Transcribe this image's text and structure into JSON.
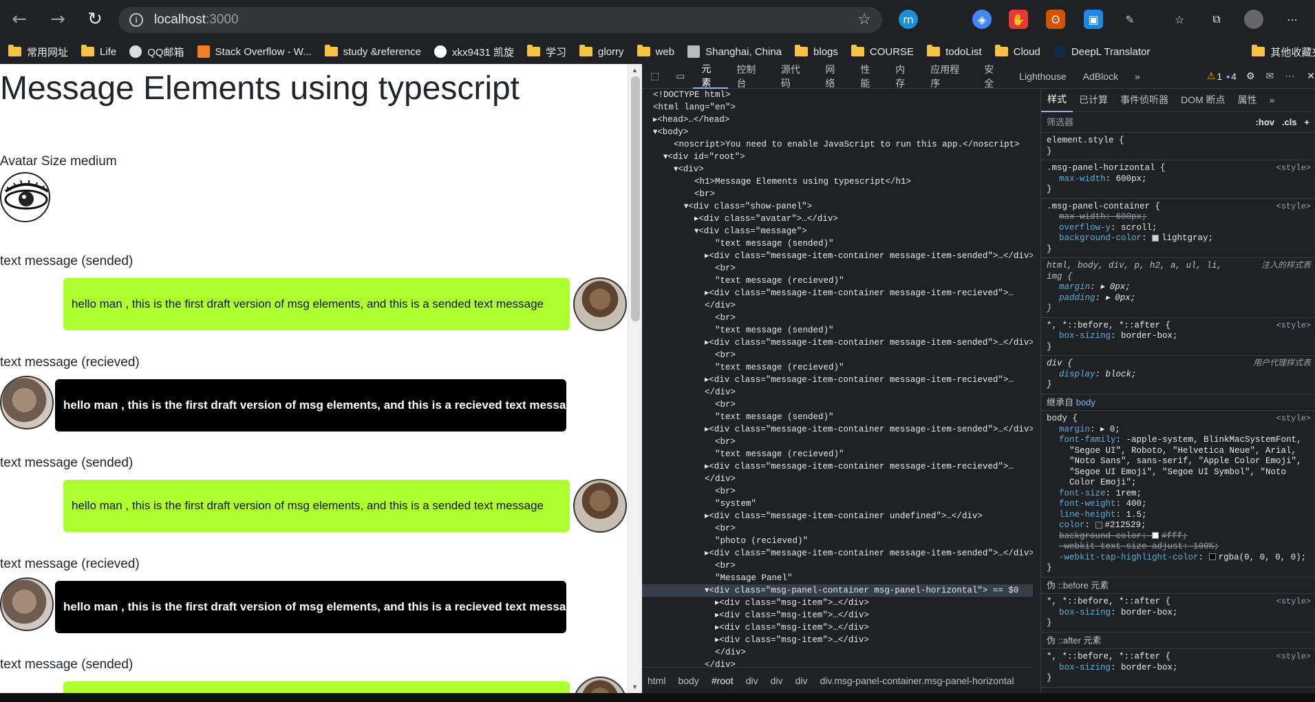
{
  "browser": {
    "url_host": "localhost",
    "url_port": ":3000",
    "bookmarks": [
      "常用网址",
      "Life",
      "QQ邮箱",
      "Stack Overflow - W...",
      "study &reference",
      "xkx9431 凯旋",
      "学习",
      "glorry",
      "web",
      "Shanghai, China",
      "blogs",
      "COURSE",
      "todoList",
      "Cloud",
      "DeepL Translator",
      "其他收藏夹"
    ],
    "extensions": [
      "m-icon",
      "chrome-ext-icon",
      "adblock-icon",
      "fox-icon",
      "blue-ext-icon",
      "pen-icon",
      "favorites-icon",
      "collections-icon",
      "profile-avatar",
      "more-icon"
    ]
  },
  "page": {
    "title": "Message Elements using typescript",
    "avatar_label": "Avatar Size medium",
    "messages": [
      {
        "label": "text message (sended)",
        "text": "hello man , this is the first draft version of msg elements, and this is a sended text message",
        "type": "sended"
      },
      {
        "label": "text message (recieved)",
        "text": "hello man , this is the first draft version of msg elements, and this is a recieved text message",
        "type": "recieved"
      },
      {
        "label": "text message (sended)",
        "text": "hello man , this is the first draft version of msg elements, and this is a sended text message",
        "type": "sended"
      },
      {
        "label": "text message (recieved)",
        "text": "hello man , this is the first draft version of msg elements, and this is a recieved text message",
        "type": "recieved"
      },
      {
        "label": "text message (sended)",
        "text": "",
        "type": "sended"
      }
    ]
  },
  "devtools": {
    "tabs": [
      "元素",
      "控制台",
      "源代码",
      "网络",
      "性能",
      "内存",
      "应用程序",
      "安全",
      "Lighthouse",
      "AdBlock"
    ],
    "warnings": "1",
    "messages": "4",
    "dom_lines": [
      "<!DOCTYPE html>",
      "<html lang=\"en\">",
      "▸<head>…</head>",
      "▾<body>",
      "    <noscript>You need to enable JavaScript to run this app.</noscript>",
      "  ▾<div id=\"root\">",
      "    ▾<div>",
      "        <h1>Message Elements using typescript</h1>",
      "        <br>",
      "      ▾<div class=\"show-panel\">",
      "        ▸<div class=\"avatar\">…</div>",
      "        ▾<div class=\"message\">",
      "            \"text message (sended)\"",
      "          ▸<div class=\"message-item-container message-item-sended\">…</div>",
      "            <br>",
      "            \"text message (recieved)\"",
      "          ▸<div class=\"message-item-container message-item-recieved\">…",
      "          </div>",
      "            <br>",
      "            \"text message (sended)\"",
      "          ▸<div class=\"message-item-container message-item-sended\">…</div>",
      "            <br>",
      "            \"text message (recieved)\"",
      "          ▸<div class=\"message-item-container message-item-recieved\">…",
      "          </div>",
      "            <br>",
      "            \"text message (sended)\"",
      "          ▸<div class=\"message-item-container message-item-sended\">…</div>",
      "            <br>",
      "            \"text message (recieved)\"",
      "          ▸<div class=\"message-item-container message-item-recieved\">…",
      "          </div>",
      "            <br>",
      "            \"system\"",
      "          ▸<div class=\"message-item-container undefined\">…</div>",
      "            <br>",
      "            \"photo (recieved)\"",
      "          ▸<div class=\"message-item-container message-item-sended\">…</div>",
      "            <br>",
      "            \"Message Panel\"",
      "          ▾<div class=\"msg-panel-container msg-panel-horizontal\"> == $0",
      "            ▸<div class=\"msg-item\">…</div>",
      "            ▸<div class=\"msg-item\">…</div>",
      "            ▸<div class=\"msg-item\">…</div>",
      "            ▸<div class=\"msg-item\">…</div>",
      "            </div>",
      "          </div>"
    ],
    "breadcrumbs": [
      "html",
      "body",
      "#root",
      "div",
      "div",
      "div",
      "div.msg-panel-container.msg-panel-horizontal"
    ],
    "style_tabs": [
      "样式",
      "已计算",
      "事件侦听器",
      "DOM 断点",
      "属性"
    ],
    "filter_placeholder": "筛选器",
    "filter_hov": ":hov",
    "filter_cls": ".cls",
    "inherited_label": "继承自",
    "inherited_from": "body",
    "before_label": "伪 ::before 元素",
    "after_label": "伪 ::after 元素"
  }
}
